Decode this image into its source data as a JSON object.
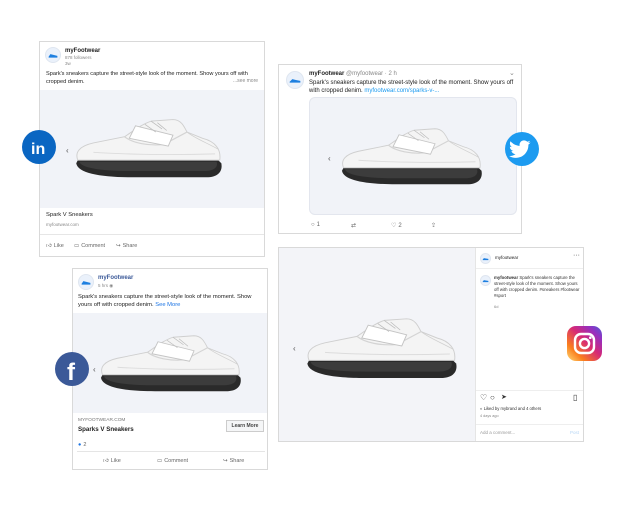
{
  "linkedin": {
    "brand": "myFootwear",
    "followers": "878 followers",
    "time": "3w",
    "caption": "Spark's sneakers capture the street-style look of the moment. Show yours off with cropped denim.",
    "see_more": "...see more",
    "product_title": "Spark V Sneakers",
    "product_domain": "myfootwear.com",
    "actions": [
      "Like",
      "Comment",
      "Share"
    ]
  },
  "twitter": {
    "brand": "myFootwear",
    "handle": "@myfootwear",
    "time": "· 2 h",
    "caption": "Spark's sneakers capture the street-style look of the moment. Show yours off with cropped denim.",
    "link": "myfootwear.com/sparks-v-...",
    "counts": {
      "reply": "1",
      "like": "2"
    }
  },
  "facebook": {
    "brand": "myFootwear",
    "time": "5 hrs",
    "caption": "Spark's sneakers capture the street-style look of the moment. Show yours off with cropped denim.",
    "see_more": "See More",
    "domain": "MYFOOTWEAR.COM",
    "product_title": "Sparks V Sneakers",
    "cta": "Learn More",
    "reactions": "2",
    "actions": [
      "Like",
      "Comment",
      "Share"
    ]
  },
  "instagram": {
    "brand": "myfootwear",
    "caption_brand": "myfootwear",
    "caption": "Spark's sneakers capture the street-style look of the moment. Show yours off with cropped denim. #sneakers #footwear #sport",
    "caption_time": "6d",
    "liked_by": "Liked by mybrand and 4 others",
    "time": "4 days ago",
    "comment_placeholder": "Add a comment...",
    "post_label": "Post"
  },
  "colors": {
    "linkedin": "#0a66c2",
    "twitter": "#1d9bf0",
    "facebook": "#3b5998",
    "link_blue": "#1b74e4"
  },
  "icons": [
    "linkedin-logo-icon",
    "twitter-logo-icon",
    "facebook-logo-icon",
    "instagram-logo-icon",
    "sneaker-image",
    "chevron-left-icon",
    "chevron-down-icon",
    "more-icon"
  ]
}
